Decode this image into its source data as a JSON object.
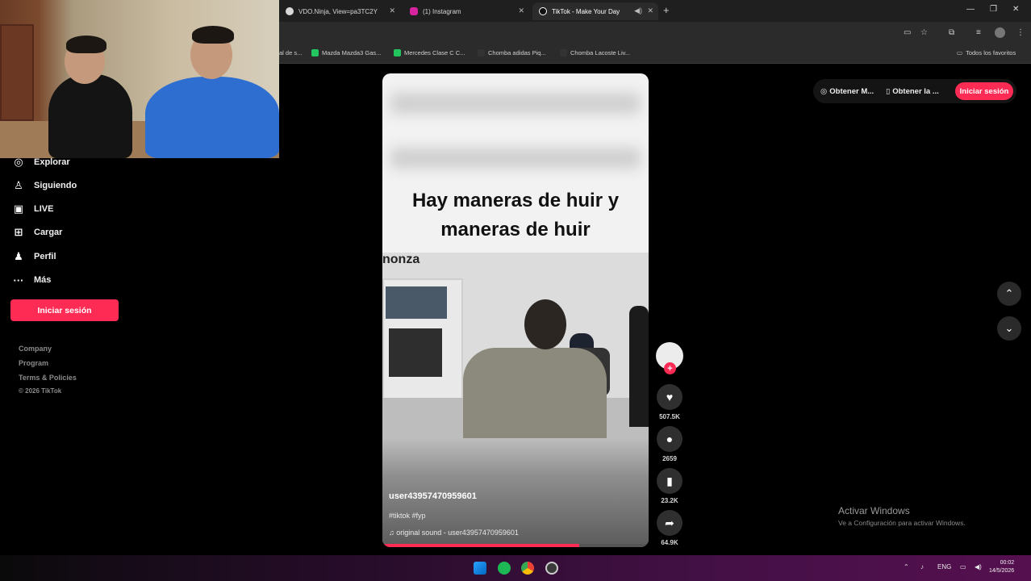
{
  "browser": {
    "tabs": [
      {
        "title": "VDO.Ninja, View=pa3TC2Y",
        "icon": "vdo-ninja-icon",
        "color": "#d9d9d9"
      },
      {
        "title": "(1) Instagram",
        "icon": "instagram-icon",
        "color": "#d6249f"
      },
      {
        "title": "TikTok - Make Your Day",
        "icon": "tiktok-icon",
        "color": "#ffffff",
        "active": true
      }
    ],
    "bookmarks": [
      {
        "label": "al de s...",
        "color": "#777777"
      },
      {
        "label": "Mazda Mazda3 Gas...",
        "color": "#22c55e"
      },
      {
        "label": "Mercedes Clase C C...",
        "color": "#22c55e"
      },
      {
        "label": "Chomba adidas Piq...",
        "color": "#333333"
      },
      {
        "label": "Chomba Lacoste Liv...",
        "color": "#333333"
      }
    ],
    "favorites_label": "Todos los favoritos"
  },
  "header": {
    "get_app_1": "Obtener M...",
    "get_app_2": "Obtener la ...",
    "login": "Iniciar sesión"
  },
  "sidebar": {
    "items": [
      {
        "label": "Explorar",
        "icon": "compass-icon"
      },
      {
        "label": "Siguiendo",
        "icon": "user-follow-icon"
      },
      {
        "label": "LIVE",
        "icon": "live-tv-icon"
      },
      {
        "label": "Cargar",
        "icon": "upload-plus-icon"
      },
      {
        "label": "Perfil",
        "icon": "profile-icon"
      },
      {
        "label": "Más",
        "icon": "more-dots-icon"
      }
    ],
    "login": "Iniciar sesión",
    "footer": {
      "company": "Company",
      "program": "Program",
      "terms": "Terms & Policies",
      "copyright": "© 2026 TikTok"
    }
  },
  "video": {
    "caption_line1": "Hay maneras de huir y",
    "caption_line2": "maneras de huir",
    "overlay_text": "nonza",
    "username": "user43957470959601",
    "tags": "#tiktok #fyp",
    "sound": "original sound - user43957470959601",
    "progress_fraction": 0.74
  },
  "actions": {
    "likes": "507.5K",
    "comments": "2659",
    "saves": "23.2K",
    "shares": "64.9K"
  },
  "windows": {
    "activate_title": "Activar Windows",
    "activate_sub": "Ve a Configuración para activar Windows.",
    "lang": "ENG",
    "time": "00:02",
    "date": "14/5/2026"
  }
}
